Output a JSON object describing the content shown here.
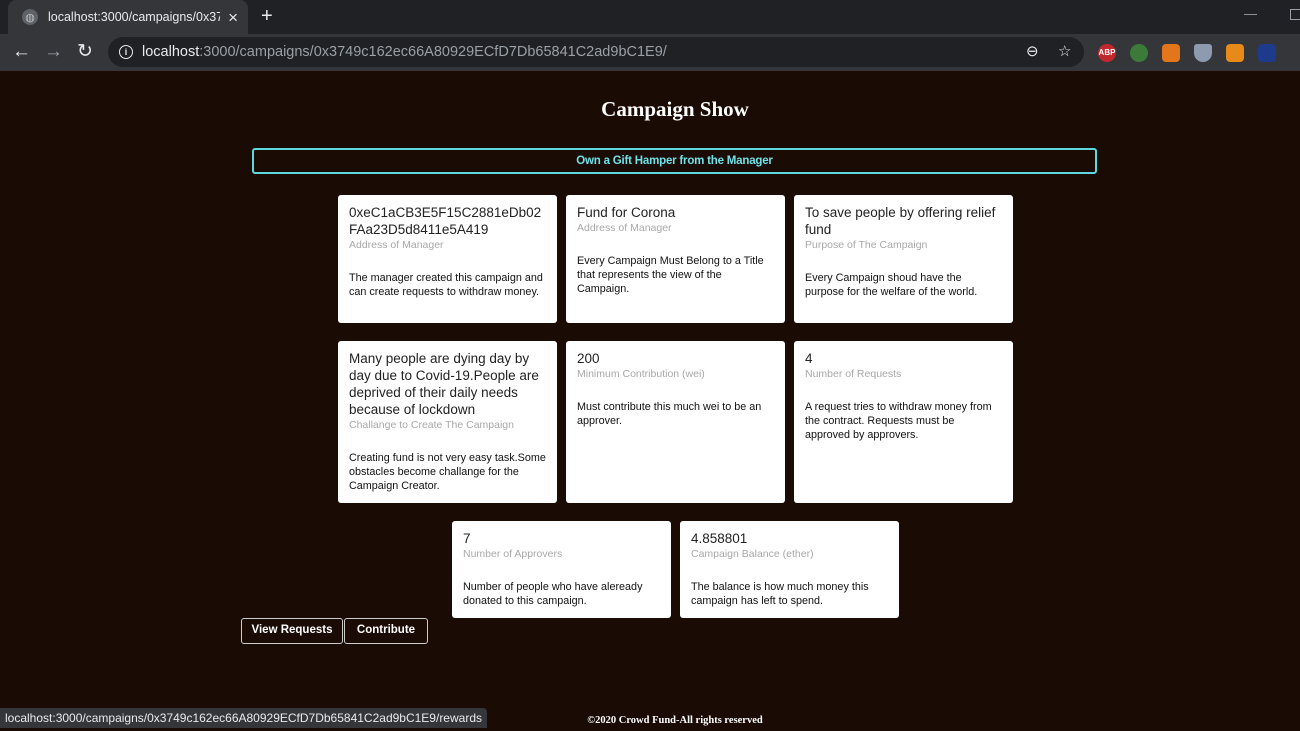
{
  "browser": {
    "tab_title": "localhost:3000/campaigns/0x374",
    "tab_close": "×",
    "new_tab": "+",
    "url_host": "localhost",
    "url_rest": ":3000/campaigns/0x3749c162ec66A80929ECfD7Db65841C2ad9bC1E9/",
    "status_url": "localhost:3000/campaigns/0x3749c162ec66A80929ECfD7Db65841C2ad9bC1E9/rewards",
    "extensions": [
      "ABP"
    ]
  },
  "page": {
    "title": "Campaign Show",
    "gift_button": "Own a Gift Hamper from the Manager",
    "cards": [
      {
        "header": "0xeC1aCB3E5F15C2881eDb02FAa23D5d8411e5A419",
        "meta": "Address of Manager",
        "description": "The manager created this campaign and can create requests to withdraw money."
      },
      {
        "header": "Fund for Corona",
        "meta": "Address of Manager",
        "description": "Every Campaign Must Belong to a Title that represents the view of the Campaign."
      },
      {
        "header": "To save people by offering relief fund",
        "meta": "Purpose of The Campaign",
        "description": "Every Campaign shoud have the purpose for the welfare of the world."
      },
      {
        "header": "Many people are dying day by day due to Covid-19.People are deprived of their daily needs because of lockdown",
        "meta": "Challange to Create The Campaign",
        "description": "Creating fund is not very easy task.Some obstacles become challange for the Campaign Creator."
      },
      {
        "header": "200",
        "meta": "Minimum Contribution (wei)",
        "description": "Must contribute this much wei to be an approver."
      },
      {
        "header": "4",
        "meta": "Number of Requests",
        "description": "A request tries to withdraw money from the contract. Requests must be approved by approvers."
      },
      {
        "header": "7",
        "meta": "Number of Approvers",
        "description": "Number of people who have aleready donated to this campaign."
      },
      {
        "header": "4.858801",
        "meta": "Campaign Balance (ether)",
        "description": "The balance is how much money this campaign has left to spend."
      }
    ],
    "view_requests": "View Requests",
    "contribute": "Contribute",
    "footer": "©2020 Crowd Fund-All rights reserved"
  }
}
